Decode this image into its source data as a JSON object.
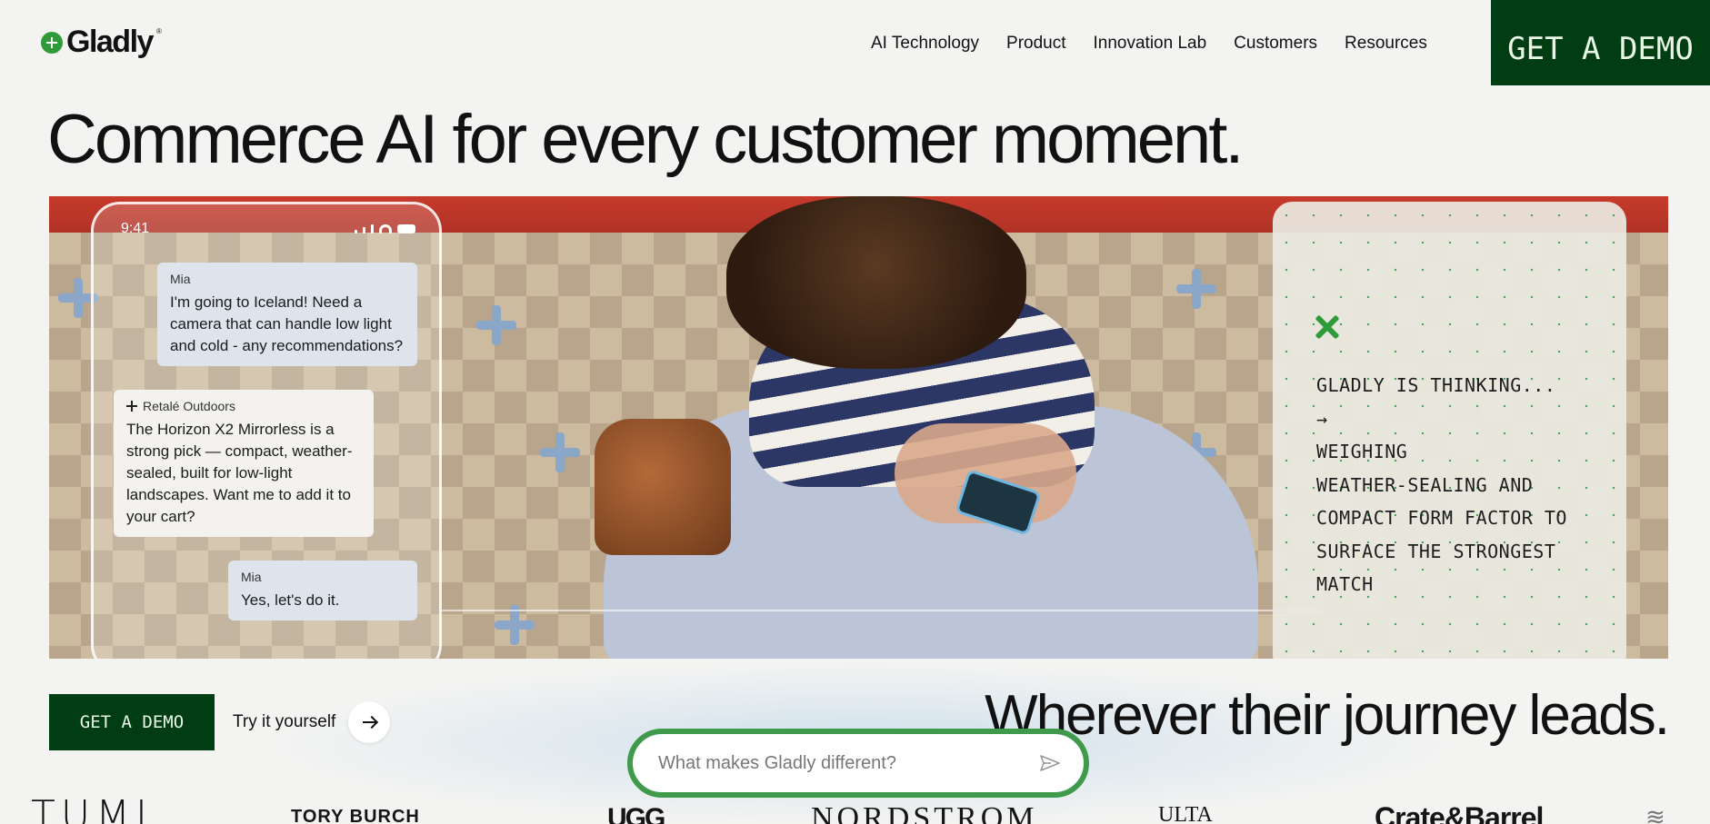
{
  "header": {
    "logo_text": "Gladly",
    "logo_tm": "®",
    "nav": [
      "AI Technology",
      "Product",
      "Innovation Lab",
      "Customers",
      "Resources"
    ],
    "cta_label": "GET A DEMO"
  },
  "hero": {
    "headline": "Commerce AI for every customer moment.",
    "phone": {
      "time": "9:41",
      "messages": [
        {
          "author": "Mia",
          "text": "I'm going to Iceland! Need a camera that can handle low light and cold - any recommendations?"
        },
        {
          "author": "Retalé Outdoors",
          "text": "The Horizon X2 Mirrorless is a strong pick — compact, weather-sealed, built for low-light landscapes. Want me to add it to your cart?"
        },
        {
          "author": "Mia",
          "text": "Yes, let's do it."
        }
      ]
    },
    "thinking": {
      "text": "GLADLY IS THINKING...\n→\nWEIGHING\nWEATHER-SEALING AND\nCOMPACT FORM FACTOR TO\nSURFACE THE STRONGEST\nMATCH"
    }
  },
  "actions": {
    "demo_label": "GET A DEMO",
    "try_label": "Try it yourself"
  },
  "tagline": "Wherever their journey leads.",
  "ask": {
    "placeholder": "What makes Gladly different?"
  },
  "logos": [
    "TUMI",
    "TORY BURCH",
    "UGG",
    "NORDSTROM",
    "ULTA",
    "Crate&Barrel",
    "≋"
  ],
  "colors": {
    "brand_green": "#003d12",
    "accent_green": "#2f9a3a",
    "page_bg": "#f3f3f2"
  }
}
